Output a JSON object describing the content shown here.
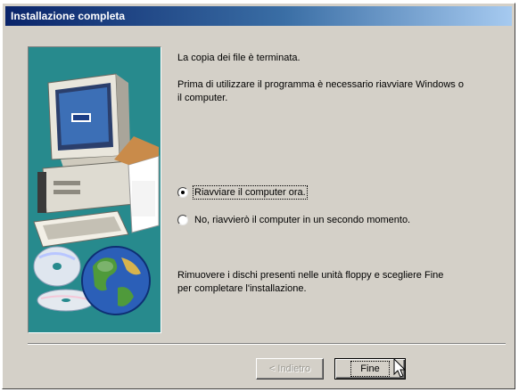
{
  "window": {
    "title": "Installazione completa"
  },
  "message": {
    "line1": "La copia dei file è terminata.",
    "line2a": "Prima di utilizzare il programma è necessario riavviare Windows o",
    "line2b": "il computer."
  },
  "options": [
    {
      "label": "Riavviare il computer ora.",
      "checked": true
    },
    {
      "label": "No, riavvierò il computer in un secondo momento.",
      "checked": false
    }
  ],
  "instructions": {
    "line1": "Rimuovere i dischi presenti nelle unità floppy e scegliere Fine",
    "line2": "per completare l'installazione."
  },
  "buttons": {
    "back": "< Indietro",
    "finish": "Fine"
  },
  "colors": {
    "title_bar_start": "#0a246a",
    "title_bar_end": "#a6caf0",
    "dialog_face": "#d4d0c8",
    "art_background": "#278a8d"
  },
  "icons": {
    "illustration": "computer-cd-globe-illustration",
    "cursor": "mouse-pointer-arrow"
  }
}
